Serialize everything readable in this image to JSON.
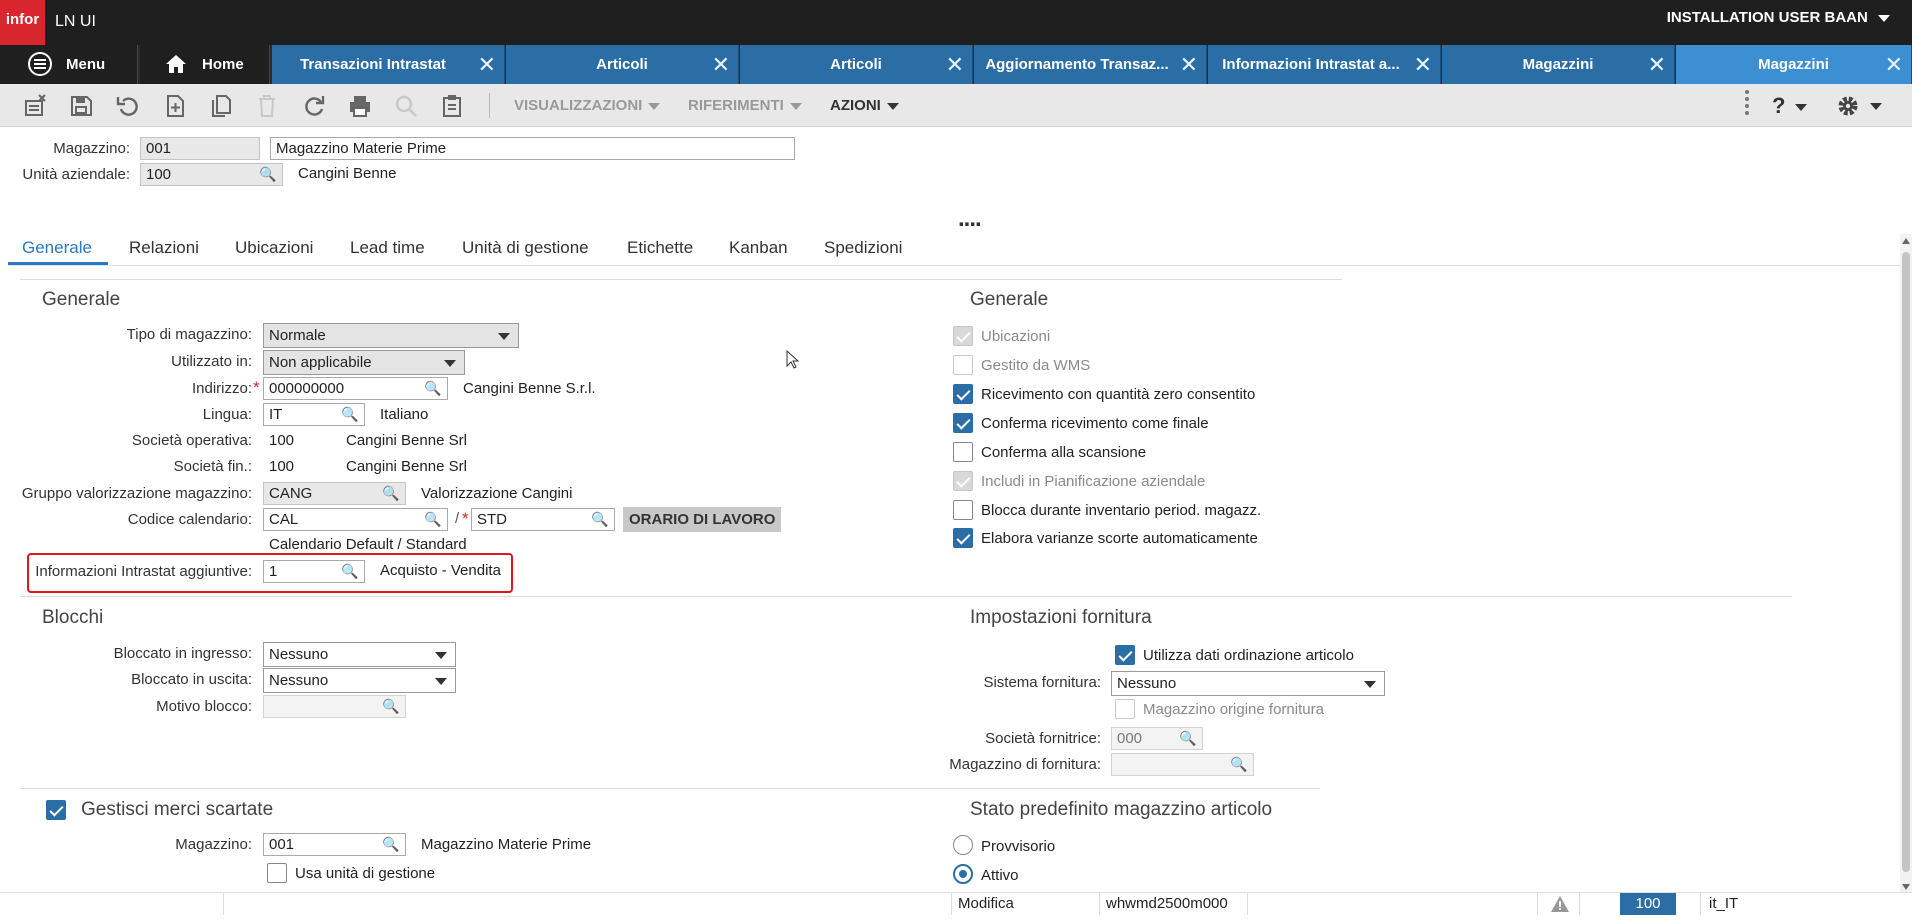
{
  "app": {
    "logo": "infor",
    "title": "LN UI",
    "user": "INSTALLATION USER BAAN"
  },
  "tabs": [
    {
      "label": "Menu"
    },
    {
      "label": "Home"
    },
    {
      "label": "Transazioni Intrastat"
    },
    {
      "label": "Articoli"
    },
    {
      "label": "Articoli"
    },
    {
      "label": "Aggiornamento Transaz..."
    },
    {
      "label": "Informazioni Intrastat a..."
    },
    {
      "label": "Magazzini"
    },
    {
      "label": "Magazzini"
    }
  ],
  "toolbar": {
    "views": "VISUALIZZAZIONI",
    "references": "RIFERIMENTI",
    "actions": "AZIONI",
    "help": "?"
  },
  "header": {
    "warehouse_label": "Magazzino:",
    "warehouse_code": "001",
    "warehouse_desc": "Magazzino Materie Prime",
    "unit_label": "Unità aziendale:",
    "unit_code": "100",
    "unit_desc": "Cangini Benne"
  },
  "more_indicator": "....",
  "form_tabs": [
    "Generale",
    "Relazioni",
    "Ubicazioni",
    "Lead time",
    "Unità di gestione",
    "Etichette",
    "Kanban",
    "Spedizioni"
  ],
  "general": {
    "title": "Generale",
    "type_label": "Tipo di magazzino:",
    "type_value": "Normale",
    "used_label": "Utilizzato in:",
    "used_value": "Non applicabile",
    "address_label": "Indirizzo:",
    "address_code": "000000000",
    "address_desc": "Cangini Benne S.r.l.",
    "lang_label": "Lingua:",
    "lang_code": "IT",
    "lang_desc": "Italiano",
    "opco_label": "Società operativa:",
    "opco_code": "100",
    "opco_desc": "Cangini Benne Srl",
    "finco_label": "Società fin.:",
    "finco_code": "100",
    "finco_desc": "Cangini Benne Srl",
    "valgrp_label": "Gruppo valorizzazione magazzino:",
    "valgrp_code": "CANG",
    "valgrp_desc": "Valorizzazione Cangini",
    "cal_label": "Codice calendario:",
    "cal_code": "CAL",
    "cal_sep": "/",
    "cal_code2": "STD",
    "cal_button": "ORARIO DI LAVORO",
    "cal_desc": "Calendario Default / Standard",
    "intrastat_label": "Informazioni Intrastat aggiuntive:",
    "intrastat_code": "1",
    "intrastat_desc": "Acquisto - Vendita",
    "required_mark": "*"
  },
  "general_right": {
    "title": "Generale",
    "items": [
      {
        "label": "Ubicazioni",
        "state": "disabled-checked"
      },
      {
        "label": "Gestito da WMS",
        "state": "disabled-unchecked"
      },
      {
        "label": "Ricevimento con quantità zero consentito",
        "state": "checked"
      },
      {
        "label": "Conferma ricevimento come finale",
        "state": "checked"
      },
      {
        "label": "Conferma alla scansione",
        "state": "unchecked"
      },
      {
        "label": "Includi in Pianificazione aziendale",
        "state": "disabled-checked"
      },
      {
        "label": "Blocca durante inventario period. magazz.",
        "state": "unchecked"
      },
      {
        "label": "Elabora varianze scorte automaticamente",
        "state": "checked"
      }
    ]
  },
  "blocks": {
    "title": "Blocchi",
    "in_label": "Bloccato in ingresso:",
    "in_value": "Nessuno",
    "out_label": "Bloccato in uscita:",
    "out_value": "Nessuno",
    "reason_label": "Motivo blocco:"
  },
  "supply": {
    "title": "Impostazioni fornitura",
    "use_item_label": "Utilizza dati ordinazione articolo",
    "system_label": "Sistema fornitura:",
    "system_value": "Nessuno",
    "origin_label": "Magazzino origine fornitura",
    "company_label": "Società fornitrice:",
    "company_value": "000",
    "wh_label": "Magazzino di fornitura:"
  },
  "scrap": {
    "title": "Gestisci merci scartate",
    "wh_label": "Magazzino:",
    "wh_code": "001",
    "wh_desc": "Magazzino Materie Prime",
    "hu_label": "Usa unità di gestione"
  },
  "default_state": {
    "title": "Stato predefinito magazzino articolo",
    "opt1": "Provvisorio",
    "opt2": "Attivo"
  },
  "status": {
    "mode": "Modifica",
    "session": "whwmd2500m000",
    "company": "100",
    "locale": "it_IT"
  },
  "colors": {
    "brand": "#d9262e",
    "tab": "#2b6ea5",
    "tab_active": "#3d8fd3",
    "highlight": "#e0161f"
  }
}
